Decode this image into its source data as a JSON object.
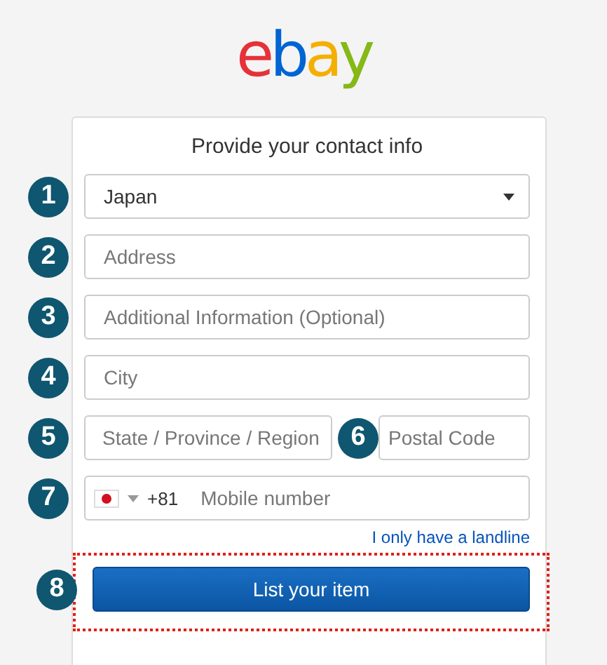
{
  "logo": {
    "letters": [
      {
        "text": "e",
        "color": "#e53238"
      },
      {
        "text": "b",
        "color": "#0064d2"
      },
      {
        "text": "a",
        "color": "#f5af02"
      },
      {
        "text": "y",
        "color": "#86b817"
      }
    ]
  },
  "form": {
    "title": "Provide your contact info",
    "fields": [
      {
        "kind": "select",
        "badge": "1",
        "value": "Japan"
      },
      {
        "kind": "text",
        "badge": "2",
        "placeholder": "Address"
      },
      {
        "kind": "text",
        "badge": "3",
        "placeholder": "Additional Information (Optional)"
      },
      {
        "kind": "text",
        "badge": "4",
        "placeholder": "City"
      },
      {
        "kind": "pair",
        "badge": "5",
        "placeholder": "State / Province / Region",
        "second": {
          "badge": "6",
          "placeholder": "Postal Code"
        }
      },
      {
        "kind": "phone",
        "badge": "7",
        "code": "+81",
        "placeholder": "Mobile number"
      }
    ],
    "link": "I only have a landline",
    "button": {
      "badge": "8",
      "label": "List your item"
    }
  }
}
